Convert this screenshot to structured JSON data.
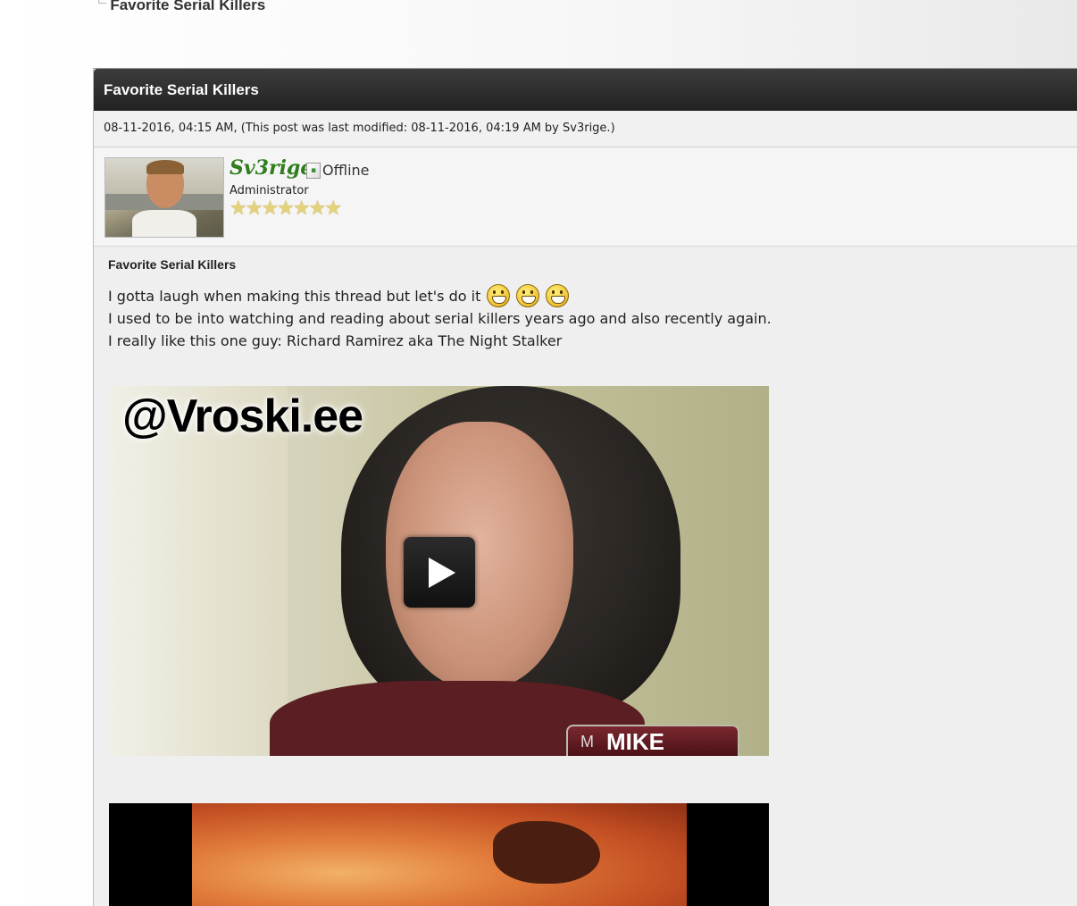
{
  "breadcrumb": {
    "current": "Favorite Serial Killers"
  },
  "thread": {
    "header_title": "Favorite Serial Killers"
  },
  "post": {
    "meta": "08-11-2016, 04:15 AM, (This post was last modified: 08-11-2016, 04:19 AM by Sv3rige.)",
    "author": {
      "name": "Sv3rige",
      "name_color": "#2f7d1e",
      "status_alt": "Offline",
      "role": "Administrator",
      "stars": "★★★★★★★"
    },
    "subject": "Favorite Serial Killers",
    "lines": [
      "I gotta laugh when making this thread but let's do it",
      "I used to be into watching and reading about serial killers years ago and also recently again.",
      "I really like this one guy: Richard Ramirez aka The Night Stalker"
    ],
    "emoji_icons": [
      "grin-icon",
      "grin-icon",
      "grin-icon"
    ]
  },
  "video1": {
    "watermark": "@Vroski.ee",
    "lower_third_logo": "M",
    "lower_third_caption": "MIKE"
  },
  "colors": {
    "header_bg": "#2a2a2a",
    "page_bg": "#f4f4f4"
  }
}
